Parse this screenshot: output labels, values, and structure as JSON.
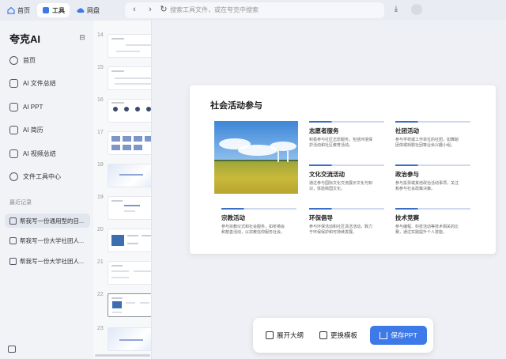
{
  "topbar": {
    "tabs": [
      {
        "label": "首页",
        "icon": "home-icon"
      },
      {
        "label": "工具",
        "icon": "tools-icon"
      },
      {
        "label": "网盘",
        "icon": "cloud-icon"
      }
    ],
    "search_placeholder": "搜索工具文件，或在夸克中搜索"
  },
  "sidebar": {
    "logo": "夸克AI",
    "nav": [
      {
        "label": "首页",
        "icon": "home-icon"
      },
      {
        "label": "AI 文件总结",
        "icon": "file-summary-icon"
      },
      {
        "label": "AI PPT",
        "icon": "ppt-icon"
      },
      {
        "label": "AI 简历",
        "icon": "resume-icon"
      },
      {
        "label": "AI 视频总结",
        "icon": "video-summary-icon"
      },
      {
        "label": "文件工具中心",
        "icon": "file-tools-icon"
      }
    ],
    "recent_label": "最近记录",
    "recent": [
      "帮我写一份通用型的目...",
      "帮我写一份大学社团人...",
      "帮我写一份大学社团人..."
    ]
  },
  "thumbnails": {
    "numbers": [
      "14",
      "15",
      "16",
      "17",
      "18",
      "19",
      "20",
      "21",
      "22",
      "23"
    ],
    "active": "22"
  },
  "slide": {
    "title": "社会活动参与",
    "items": [
      {
        "title": "志愿者服务",
        "desc": "积极参与社区志愿服务，包括环境保护活动和社区教育活动。"
      },
      {
        "title": "社团活动",
        "desc": "参与学校或工作单位的社团，如舞蹈团体或戏剧社团等业余兴趣小组。"
      },
      {
        "title": "文化交流活动",
        "desc": "通过参与国际文化交流展示文化与知识，体验跨国文化。"
      },
      {
        "title": "政治参与",
        "desc": "参与投票或其他政治活动事项，关注和参与社会政策决策。"
      },
      {
        "title": "宗教活动",
        "desc": "参与宗教仪式和社会服务，如祈祷会和慈善活动，以宗教信仰服务社会。"
      },
      {
        "title": "环保倡导",
        "desc": "参与环保活动和社区清洁活动，致力于环保保护和可持续发展。"
      },
      {
        "title": "技术竞赛",
        "desc": "参与编程、科技活动等技术相关的比赛，通过实践提升个人技能。"
      }
    ]
  },
  "toolbar": {
    "expand_outline": "展开大纲",
    "change_template": "更换模板",
    "save_ppt": "保存PPT"
  },
  "colors": {
    "accent": "#3d7ae8",
    "sidebar_bg": "#f1f3f7"
  }
}
